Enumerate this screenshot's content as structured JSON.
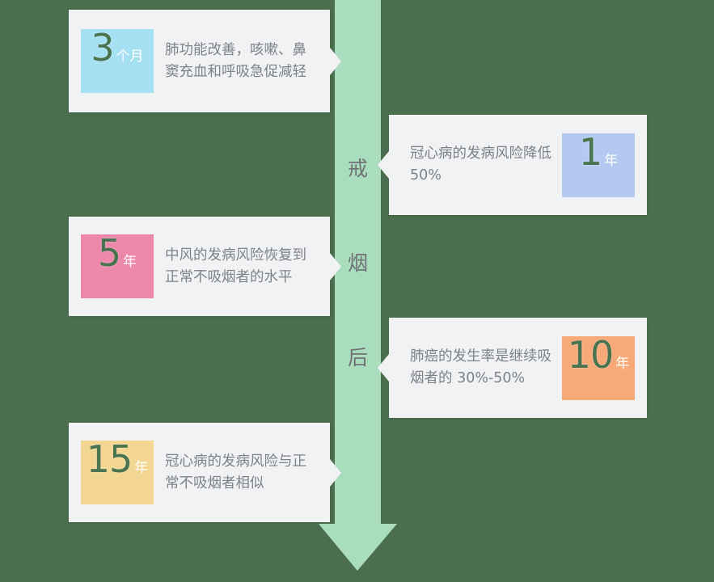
{
  "background_color": "#4b6f4e",
  "axis": {
    "name": "timeline-arrow",
    "color": "#aaddbd",
    "label_chars": [
      "戒",
      "烟",
      "后"
    ],
    "label_text": "戒烟后",
    "label_color": "#6f7276",
    "direction": "down"
  },
  "card_background": "#f1f2f4",
  "description_color": "#7d8287",
  "number_color": "#4a7350",
  "unit_color": "#ffffff",
  "milestones": [
    {
      "id": "milestone-3-months",
      "side": "left",
      "number": "3",
      "unit": "个月",
      "swatch_color": "#a5e1f2",
      "description": "肺功能改善，咳嗽、鼻窦充血和呼吸急促减轻"
    },
    {
      "id": "milestone-1-year",
      "side": "right",
      "number": "1",
      "unit": "年",
      "swatch_color": "#b4c8f0",
      "description": "冠心病的发病风险降低 50%"
    },
    {
      "id": "milestone-5-years",
      "side": "left",
      "number": "5",
      "unit": "年",
      "swatch_color": "#ed88ab",
      "description": "中风的发病风险恢复到正常不吸烟者的水平"
    },
    {
      "id": "milestone-10-years",
      "side": "right",
      "number": "10",
      "unit": "年",
      "swatch_color": "#f7a977",
      "description": "肺癌的发生率是继续吸烟者的 30%-50%"
    },
    {
      "id": "milestone-15-years",
      "side": "left",
      "number": "15",
      "unit": "年",
      "swatch_color": "#f3d691",
      "description": "冠心病的发病风险与正常不吸烟者相似"
    }
  ]
}
